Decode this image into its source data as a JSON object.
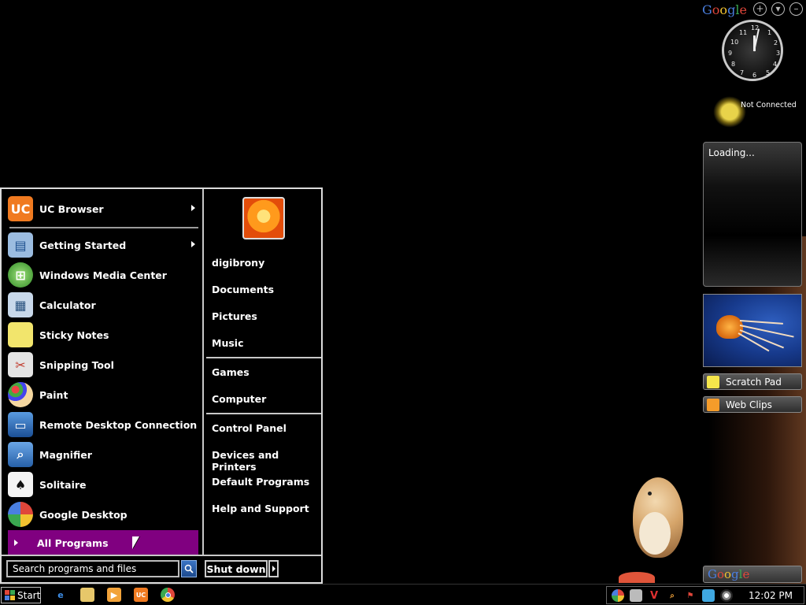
{
  "start_menu": {
    "programs": [
      {
        "label": "UC Browser",
        "icon": "uc-browser-icon",
        "has_submenu": true
      },
      {
        "label": "Getting Started",
        "icon": "getting-started-icon",
        "has_submenu": true
      },
      {
        "label": "Windows Media Center",
        "icon": "media-center-icon",
        "has_submenu": false
      },
      {
        "label": "Calculator",
        "icon": "calculator-icon",
        "has_submenu": false
      },
      {
        "label": "Sticky Notes",
        "icon": "sticky-notes-icon",
        "has_submenu": false
      },
      {
        "label": "Snipping Tool",
        "icon": "scissors-icon",
        "has_submenu": false
      },
      {
        "label": "Paint",
        "icon": "paint-palette-icon",
        "has_submenu": false
      },
      {
        "label": "Remote Desktop Connection",
        "icon": "remote-desktop-icon",
        "has_submenu": false
      },
      {
        "label": "Magnifier",
        "icon": "magnifier-icon",
        "has_submenu": false
      },
      {
        "label": "Solitaire",
        "icon": "solitaire-icon",
        "has_submenu": false
      },
      {
        "label": "Google Desktop",
        "icon": "google-desktop-icon",
        "has_submenu": false
      }
    ],
    "all_programs_label": "All Programs",
    "search_placeholder": "Search programs and files",
    "places": [
      {
        "label": "digibrony"
      },
      {
        "label": "Documents"
      },
      {
        "label": "Pictures"
      },
      {
        "label": "Music"
      },
      {
        "label": "Games"
      },
      {
        "label": "Computer"
      },
      {
        "label": "Control Panel"
      },
      {
        "label": "Devices and Printers"
      },
      {
        "label": "Default Programs"
      },
      {
        "label": "Help and Support"
      }
    ],
    "shutdown_label": "Shut down",
    "highlight_color": "#800080"
  },
  "taskbar": {
    "start_label": "Start",
    "pinned": [
      "internet-explorer-icon",
      "folder-icon",
      "media-player-icon",
      "uc-browser-icon",
      "chrome-icon"
    ],
    "tray_icons": [
      "google-desktop-tray-icon",
      "network-icon",
      "antivirus-icon",
      "search-tray-icon",
      "flag-icon",
      "display-icon",
      "volume-icon"
    ],
    "clock": "12:02 PM"
  },
  "sidebar": {
    "logo": "Google",
    "weather_status": "Not Connected",
    "loading_text": "Loading...",
    "scratch_pad_label": "Scratch Pad",
    "web_clips_label": "Web Clips",
    "search_logo": "Google"
  }
}
